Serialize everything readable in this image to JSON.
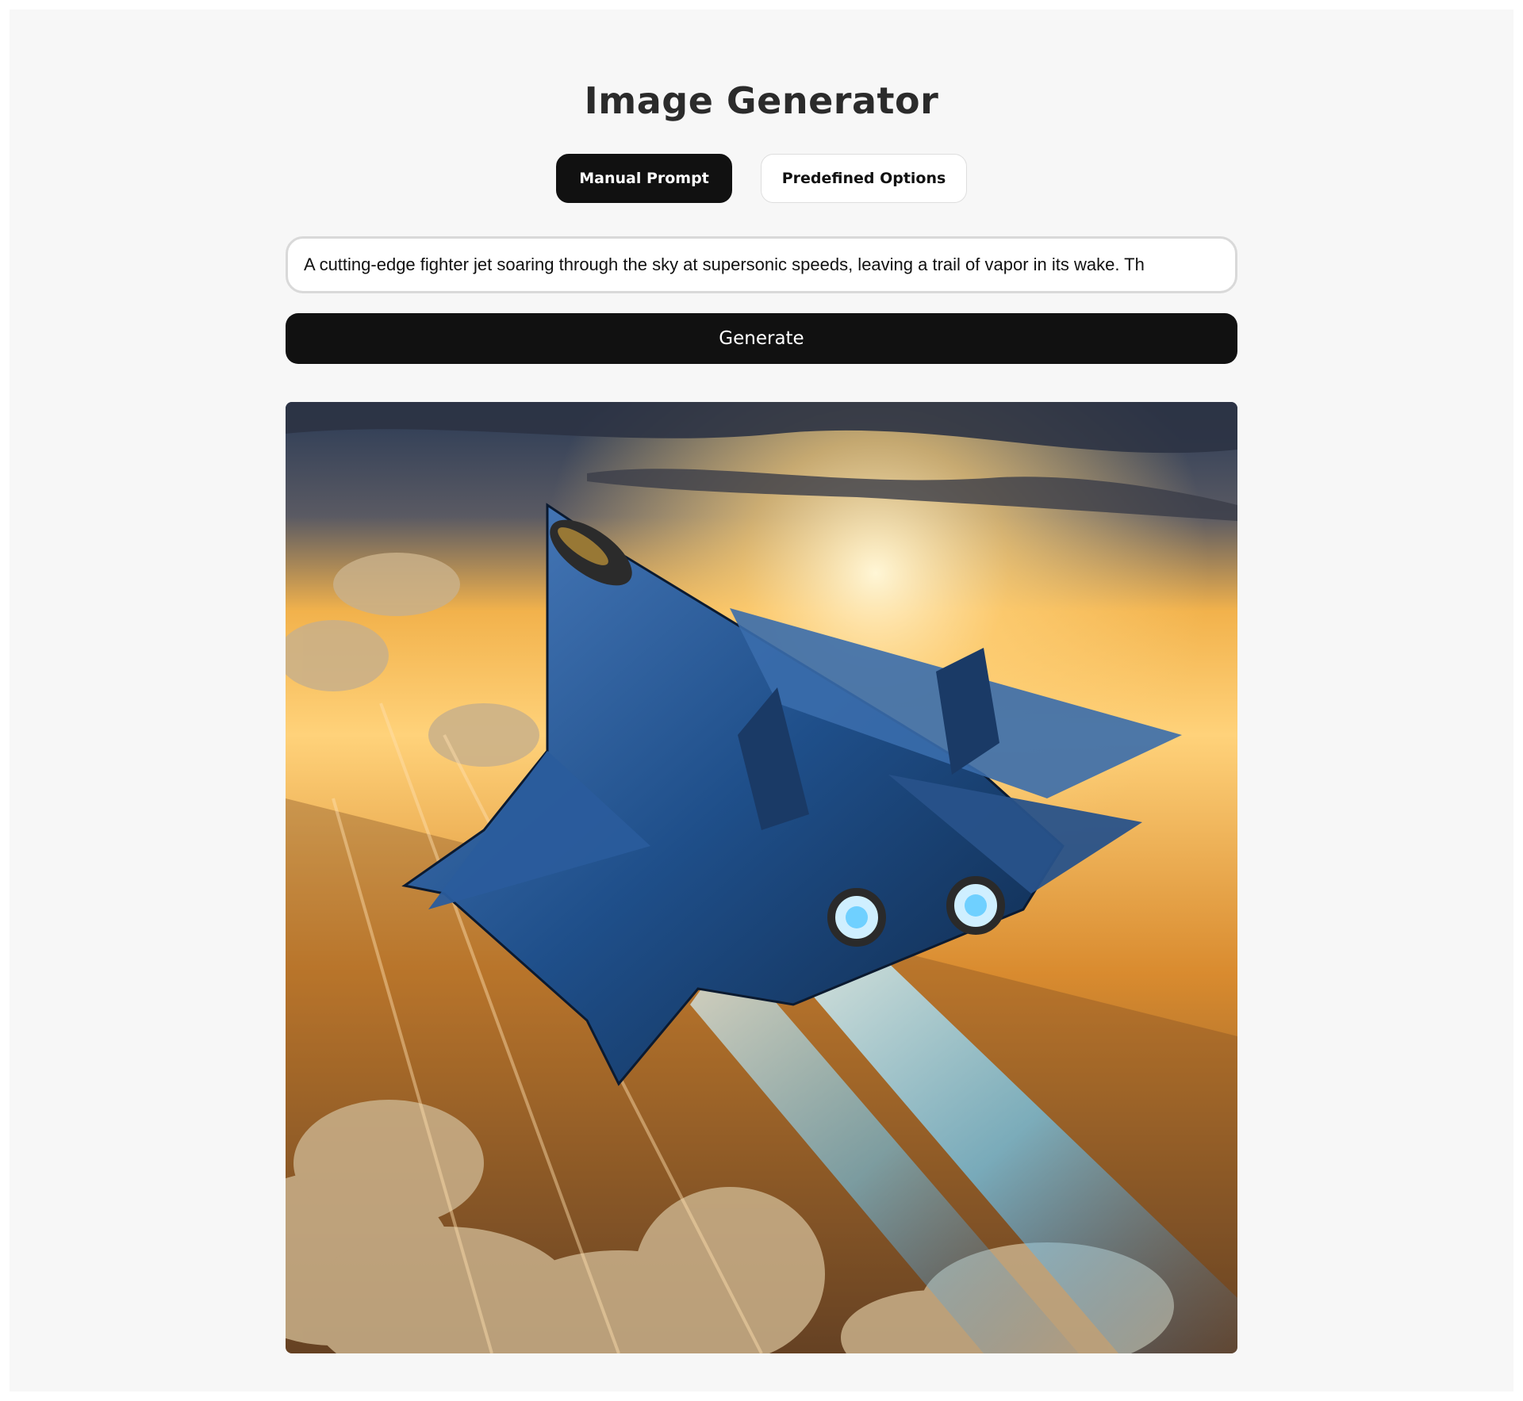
{
  "app": {
    "title": "Image Generator"
  },
  "tabs": [
    {
      "label": "Manual Prompt",
      "active": true
    },
    {
      "label": "Predefined Options",
      "active": false
    }
  ],
  "prompt": {
    "value": "A cutting-edge fighter jet soaring through the sky at supersonic speeds, leaving a trail of vapor in its wake. Th"
  },
  "generate_button": {
    "label": "Generate"
  },
  "result": {
    "image_alt": "A blue-patterned fighter jet flying over a city at sunset with glowing blue afterburner trails",
    "colors": {
      "sky_top": "#2a3a55",
      "sun": "#ffd27a",
      "horizon": "#e89a3a",
      "jet_body": "#1f4f8a",
      "afterburner": "#6fd0ff"
    }
  }
}
